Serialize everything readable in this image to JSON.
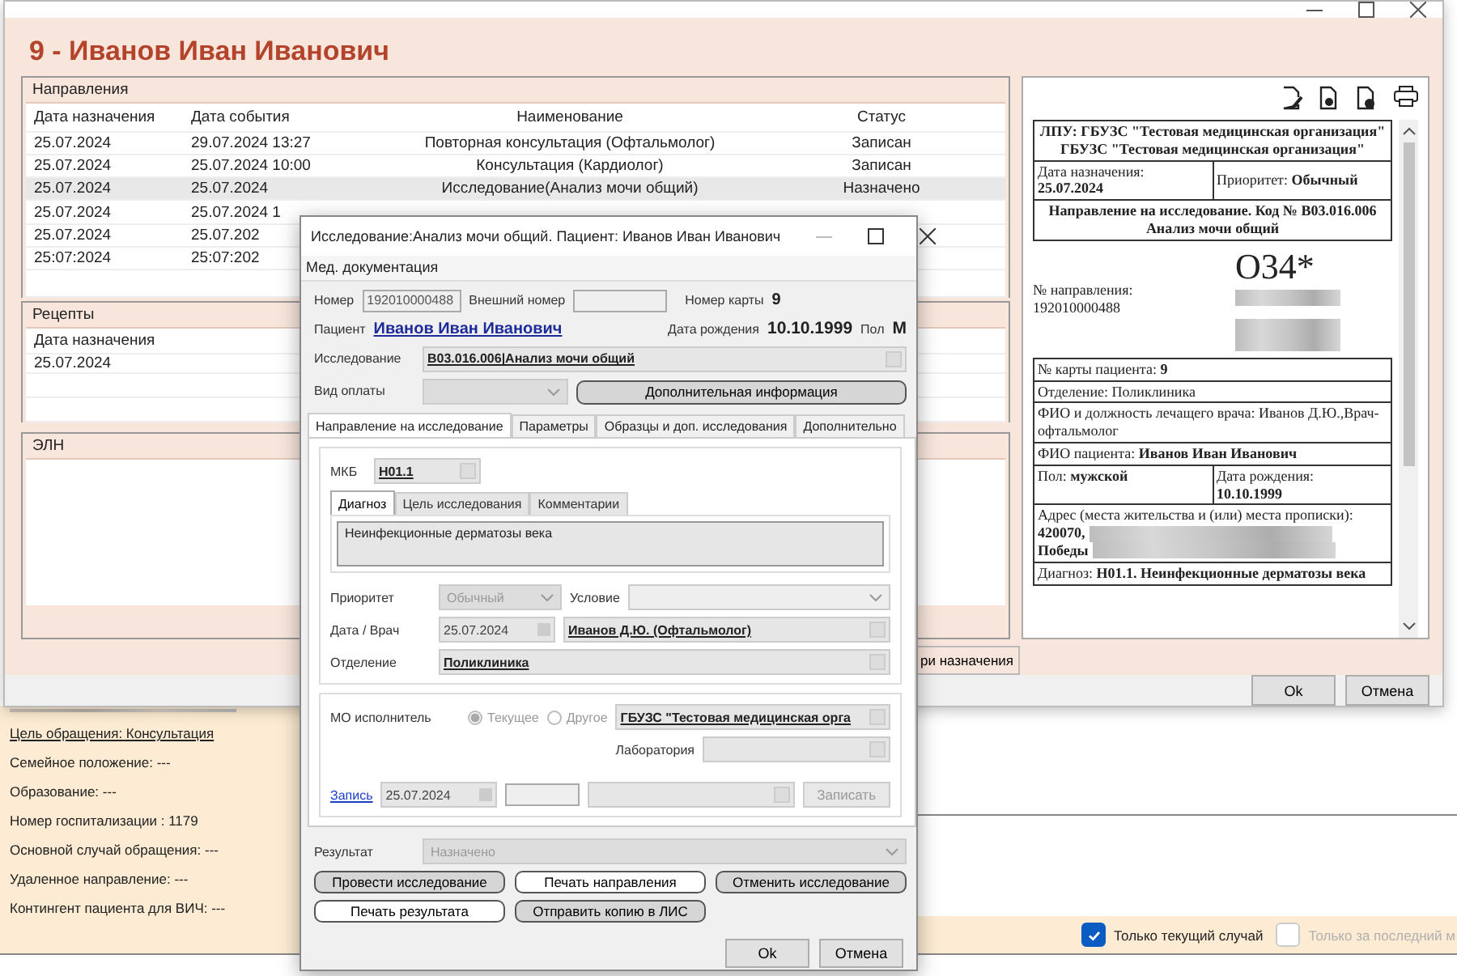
{
  "main_window": {
    "title": "9 - Иванов Иван Иванович",
    "directions": {
      "label": "Направления",
      "columns": [
        "Дата назначения",
        "Дата события",
        "Наименование",
        "Статус"
      ],
      "rows": [
        {
          "date": "25.07.2024",
          "event": "29.07.2024 13:27",
          "name": "Повторная консультация (Офтальмолог)",
          "status": "Записан",
          "selected": false
        },
        {
          "date": "25.07.2024",
          "event": "25.07.2024 10:00",
          "name": "Консультация (Кардиолог)",
          "status": "Записан",
          "selected": false
        },
        {
          "date": "25.07.2024",
          "event": "25.07.2024",
          "name": "Исследование(Анализ мочи общий)",
          "status": "Назначено",
          "selected": true
        },
        {
          "date": "25.07.2024",
          "event": "25.07.2024 1",
          "selected": false
        },
        {
          "date": "25.07.2024",
          "event": "25.07.202",
          "selected": false
        },
        {
          "date": "25:07:2024",
          "event": "25:07:202",
          "selected": false
        }
      ]
    },
    "recipes": {
      "label": "Рецепты",
      "columns": [
        "Дата назначения"
      ],
      "rows": [
        {
          "date": "25.07.2024"
        }
      ]
    },
    "eln": {
      "label": "ЭЛН"
    },
    "partial_button": "ри назначения",
    "document": {
      "header": "ЛПУ: ГБУЗС \"Тестовая медицинская организация\" ГБУЗС \"Тестовая медицинская организация\"",
      "date_label": "Дата назначения:",
      "date_value": "25.07.2024",
      "priority": "Приоритет: **Обычный**",
      "heading": "Направление на исследование. Код № B03.016.006 Анализ мочи общий",
      "code_mark": "О34*",
      "number_label": "№ направления:",
      "number_value": "192010000488",
      "rows": [
        "№ карты пациента: **9**",
        "Отделение: Поликлиника",
        "ФИО и должность лечащего врача: Иванов Д.Ю.,Врач-офтальмолог",
        "ФИО пациента: **Иванов Иван Иванович**"
      ],
      "sex": "Пол: **мужской**",
      "birth_label": "Дата рождения:",
      "birth_value": "10.10.1999",
      "address_label": "Адрес (места жительства и (или) места прописки):",
      "address_lines": [
        "420070,",
        "Победы"
      ],
      "diagnosis": "Диагноз: **H01.1. Неинфекционные дерматозы века**"
    },
    "buttons": [
      "Ok",
      "Отмена"
    ]
  },
  "dialog": {
    "title": "Исследование:Анализ мочи общий. Пациент: Иванов Иван Иванович",
    "menu": [
      "Мед. документация"
    ],
    "number_label": "Номер",
    "number": "192010000488",
    "external_label": "Внешний номер",
    "card_label": "Номер карты",
    "card": "9",
    "patient_label": "Пациент",
    "patient": "Иванов Иван Иванович",
    "birth_label": "Дата рождения",
    "birth": "10.10.1999",
    "sex_label": "Пол",
    "sex": "М",
    "study_label": "Исследование",
    "study": "B03.016.006|Анализ мочи общий",
    "payment_label": "Вид оплаты",
    "info_button": "Дополнительная информация",
    "tabs": [
      {
        "label": "Направление на исследование",
        "selected": true
      },
      {
        "label": "Параметры",
        "selected": false
      },
      {
        "label": "Образцы и доп. исследования",
        "selected": false
      },
      {
        "label": "Дополнительно",
        "selected": false
      }
    ],
    "mkb_label": "МКБ",
    "mkb": "H01.1",
    "subtabs": [
      {
        "label": "Диагноз",
        "selected": true
      },
      {
        "label": "Цель исследования",
        "selected": false
      },
      {
        "label": "Комментарии",
        "selected": false
      }
    ],
    "diagnosis": "Неинфекционные дерматозы века",
    "priority_label": "Приоритет",
    "priority": "Обычный",
    "priority_disabled": true,
    "condition_label": "Условие",
    "date_doctor_label": "Дата / Врач",
    "date": "25.07.2024",
    "doctor": "Иванов Д.Ю. (Офтальмолог)",
    "department_label": "Отделение",
    "department": "Поликлиника",
    "executor_label": "МО исполнитель",
    "executor_options": [
      {
        "label": "Текущее",
        "selected": true
      },
      {
        "label": "Другое",
        "selected": false
      }
    ],
    "organization": "ГБУЗС \"Тестовая медицинская орга",
    "lab_label": "Лаборатория",
    "record_link": "Запись",
    "record_date": "25.07.2024",
    "record_button": {
      "label": "Записать",
      "disabled": true
    },
    "result_label": "Результат",
    "result": "Назначено",
    "result_disabled": true,
    "actions": [
      {
        "label": "Провести исследование",
        "kind": "filled"
      },
      {
        "label": "Печать направления",
        "kind": "outline"
      },
      {
        "label": "Отменить исследование",
        "kind": "filled"
      },
      {
        "label": "Печать результата",
        "kind": "outline"
      },
      {
        "label": "Отправить копию в ЛИС",
        "kind": "filled"
      }
    ],
    "buttons": [
      "Ok",
      "Отмена"
    ]
  },
  "side_panel": {
    "link": "Цель обращения: Консультация",
    "lines": [
      "Семейное положение: ---",
      "Образование: ---",
      "Номер госпитализации : 1179",
      "Основной случай обращения: ---",
      "Удаленное направление: ---",
      "Контингент пациента для ВИЧ: ---"
    ]
  },
  "filters": [
    {
      "label": "Только текущий случай",
      "checked": true,
      "disabled": false
    },
    {
      "label": "Только за последний м",
      "checked": false,
      "disabled": true
    }
  ]
}
